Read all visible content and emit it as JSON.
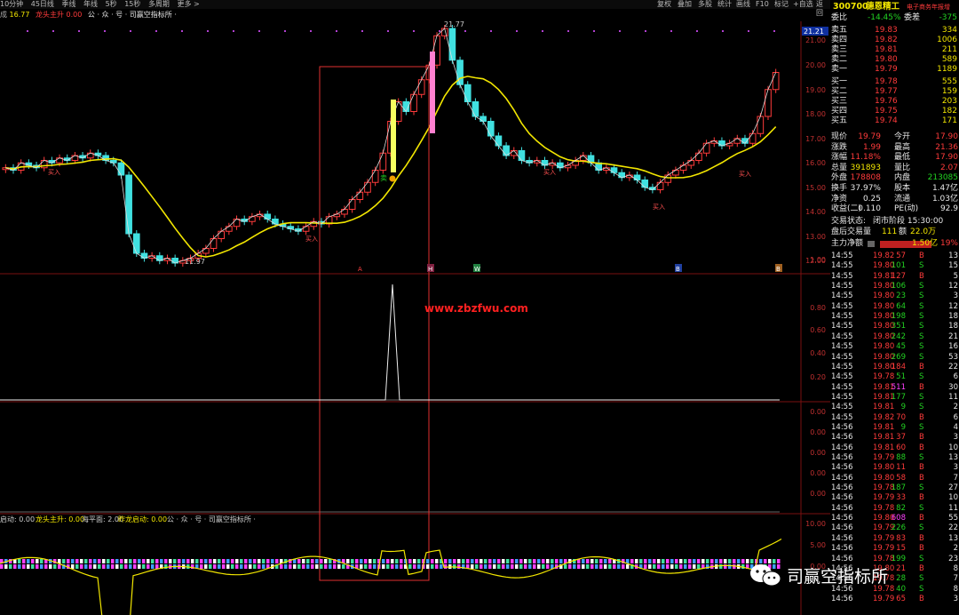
{
  "toolbar": {
    "periods": [
      "10分钟",
      "45日线",
      "季线",
      "年线",
      "5秒",
      "15秒",
      "多周期",
      "更多 >"
    ],
    "right": [
      "复权",
      "叠加",
      "多股",
      "统计",
      "画线",
      "F10",
      "标记",
      "+自选",
      "返回"
    ]
  },
  "indicator_bar": {
    "prefix": "成",
    "label1": "16.77",
    "label2": "龙头主升",
    "label3": "0.00",
    "label4": "公 · 众 · 号 · 司赢空指标所 ·"
  },
  "chart": {
    "price_labels": [
      "21.00",
      "20.00",
      "19.00",
      "18.00",
      "17.00",
      "16.00",
      "15.00",
      "14.00",
      "13.00",
      "12.00"
    ],
    "last_price_tag": "21.21",
    "high_label": "21.77",
    "low_label": "11.97",
    "buy_labels": [
      "买入",
      "买入",
      "买入",
      "买入",
      "买入"
    ],
    "sell_label": "卖",
    "markers": [
      "A",
      "H",
      "W",
      "B",
      "B"
    ],
    "osc1_labels": [
      "1.00",
      "0.80",
      "0.60",
      "0.40",
      "0.20"
    ],
    "osc2_labels": [
      "0.00",
      "0.00",
      "0.00",
      "0.00",
      "0.00"
    ],
    "bottom_indicator_bar": {
      "t1": "启动: 0.00",
      "t2": "龙头主升: 0.00",
      "t3": "海平面: 2.00",
      "t4": "昨龙启动: 0.00",
      "t5": "公 · 众 · 号 · 司赢空指标所 ·"
    },
    "osc3_labels": [
      "10.00",
      "5.00",
      "0.00"
    ],
    "watermark_site": "www.zbzfwu.com"
  },
  "quote": {
    "code": "300700",
    "name": "德恩精工",
    "tag": "电子商务年报增",
    "weibi_label": "委比",
    "weibi_value": "-14.45%",
    "weicha_label": "委差",
    "weicha_value": "-375",
    "asks": [
      {
        "label": "卖五",
        "price": "19.83",
        "vol": "334"
      },
      {
        "label": "卖四",
        "price": "19.82",
        "vol": "1006"
      },
      {
        "label": "卖三",
        "price": "19.81",
        "vol": "211"
      },
      {
        "label": "卖二",
        "price": "19.80",
        "vol": "589"
      },
      {
        "label": "卖一",
        "price": "19.79",
        "vol": "1189"
      }
    ],
    "bids": [
      {
        "label": "买一",
        "price": "19.78",
        "vol": "555"
      },
      {
        "label": "买二",
        "price": "19.77",
        "vol": "159"
      },
      {
        "label": "买三",
        "price": "19.76",
        "vol": "203"
      },
      {
        "label": "买四",
        "price": "19.75",
        "vol": "182"
      },
      {
        "label": "买五",
        "price": "19.74",
        "vol": "171"
      }
    ],
    "stats": [
      {
        "l1": "现价",
        "v1": "19.79",
        "l2": "今开",
        "v2": "17.90",
        "c1": "red",
        "c2": "red"
      },
      {
        "l1": "涨跌",
        "v1": "1.99",
        "l2": "最高",
        "v2": "21.36",
        "c1": "red",
        "c2": "red"
      },
      {
        "l1": "涨幅",
        "v1": "11.18%",
        "l2": "最低",
        "v2": "17.90",
        "c1": "red",
        "c2": "red"
      },
      {
        "l1": "总量",
        "v1": "391893",
        "l2": "量比",
        "v2": "2.07",
        "c1": "yellow",
        "c2": "red"
      },
      {
        "l1": "外盘",
        "v1": "178808",
        "l2": "内盘",
        "v2": "213085",
        "c1": "red",
        "c2": "green"
      },
      {
        "l1": "换手",
        "v1": "37.97%",
        "l2": "股本",
        "v2": "1.47亿",
        "c1": "white",
        "c2": "white"
      },
      {
        "l1": "净资",
        "v1": "0.25",
        "l2": "流通",
        "v2": "1.03亿",
        "c1": "white",
        "c2": "white"
      },
      {
        "l1": "收益(二)",
        "v1": "0.110",
        "l2": "PE(动)",
        "v2": "92.9",
        "c1": "white",
        "c2": "white"
      }
    ],
    "status_label": "交易状态:",
    "status_value": "闭市阶段 15:30:00",
    "after_label": "盘后交易量",
    "after_vol": "111",
    "after_amount_label": "额",
    "after_amount": "22.0万",
    "main_flow_label": "主力净额",
    "main_flow_value": "1.50亿",
    "main_flow_pct": "19%",
    "ticks": [
      {
        "t": "14:55",
        "p": "19.82",
        "v": "57",
        "s": "B",
        "n": "13"
      },
      {
        "t": "14:55",
        "p": "19.80",
        "v": "101",
        "s": "S",
        "n": "15"
      },
      {
        "t": "14:55",
        "p": "19.81",
        "v": "127",
        "s": "B",
        "n": "5"
      },
      {
        "t": "14:55",
        "p": "19.80",
        "v": "106",
        "s": "S",
        "n": "12"
      },
      {
        "t": "14:55",
        "p": "19.80",
        "v": "23",
        "s": "S",
        "n": "3"
      },
      {
        "t": "14:55",
        "p": "19.80",
        "v": "64",
        "s": "S",
        "n": "12"
      },
      {
        "t": "14:55",
        "p": "19.80",
        "v": "198",
        "s": "S",
        "n": "18"
      },
      {
        "t": "14:55",
        "p": "19.80",
        "v": "351",
        "s": "S",
        "n": "18"
      },
      {
        "t": "14:55",
        "p": "19.80",
        "v": "242",
        "s": "S",
        "n": "21"
      },
      {
        "t": "14:55",
        "p": "19.80",
        "v": "45",
        "s": "S",
        "n": "16"
      },
      {
        "t": "14:55",
        "p": "19.80",
        "v": "269",
        "s": "S",
        "n": "53"
      },
      {
        "t": "14:55",
        "p": "19.80",
        "v": "184",
        "s": "B",
        "n": "22"
      },
      {
        "t": "14:55",
        "p": "19.78",
        "v": "51",
        "s": "S",
        "n": "6"
      },
      {
        "t": "14:55",
        "p": "19.81",
        "v": "511",
        "s": "B",
        "n": "30"
      },
      {
        "t": "14:55",
        "p": "19.81",
        "v": "177",
        "s": "S",
        "n": "11"
      },
      {
        "t": "14:55",
        "p": "19.81",
        "v": "9",
        "s": "S",
        "n": "2"
      },
      {
        "t": "14:55",
        "p": "19.82",
        "v": "70",
        "s": "B",
        "n": "6"
      },
      {
        "t": "14:56",
        "p": "19.81",
        "v": "9",
        "s": "S",
        "n": "4"
      },
      {
        "t": "14:56",
        "p": "19.81",
        "v": "37",
        "s": "B",
        "n": "3"
      },
      {
        "t": "14:56",
        "p": "19.81",
        "v": "60",
        "s": "B",
        "n": "10"
      },
      {
        "t": "14:56",
        "p": "19.79",
        "v": "88",
        "s": "S",
        "n": "13"
      },
      {
        "t": "14:56",
        "p": "19.80",
        "v": "11",
        "s": "B",
        "n": "3"
      },
      {
        "t": "14:56",
        "p": "19.80",
        "v": "58",
        "s": "B",
        "n": "7"
      },
      {
        "t": "14:56",
        "p": "19.78",
        "v": "187",
        "s": "S",
        "n": "27"
      },
      {
        "t": "14:56",
        "p": "19.79",
        "v": "33",
        "s": "B",
        "n": "10"
      },
      {
        "t": "14:56",
        "p": "19.78",
        "v": "82",
        "s": "S",
        "n": "11"
      },
      {
        "t": "14:56",
        "p": "19.80",
        "v": "608",
        "s": "B",
        "n": "55"
      },
      {
        "t": "14:56",
        "p": "19.79",
        "v": "226",
        "s": "S",
        "n": "22"
      },
      {
        "t": "14:56",
        "p": "19.79",
        "v": "83",
        "s": "B",
        "n": "13"
      },
      {
        "t": "14:56",
        "p": "19.79",
        "v": "15",
        "s": "B",
        "n": "2"
      },
      {
        "t": "14:56",
        "p": "19.78",
        "v": "199",
        "s": "S",
        "n": "23"
      },
      {
        "t": "14:56",
        "p": "19.80",
        "v": "21",
        "s": "B",
        "n": "8"
      },
      {
        "t": "14:56",
        "p": "19.78",
        "v": "28",
        "s": "S",
        "n": "7"
      },
      {
        "t": "14:56",
        "p": "19.78",
        "v": "40",
        "s": "S",
        "n": "8"
      },
      {
        "t": "14:56",
        "p": "19.79",
        "v": "65",
        "s": "B",
        "n": "3"
      }
    ]
  },
  "watermark": {
    "text": "司赢空指标所"
  },
  "colors": {
    "up": "#ff3b3b",
    "down": "#40e0e0",
    "ma": "#f2e600",
    "box": "#e03030"
  }
}
